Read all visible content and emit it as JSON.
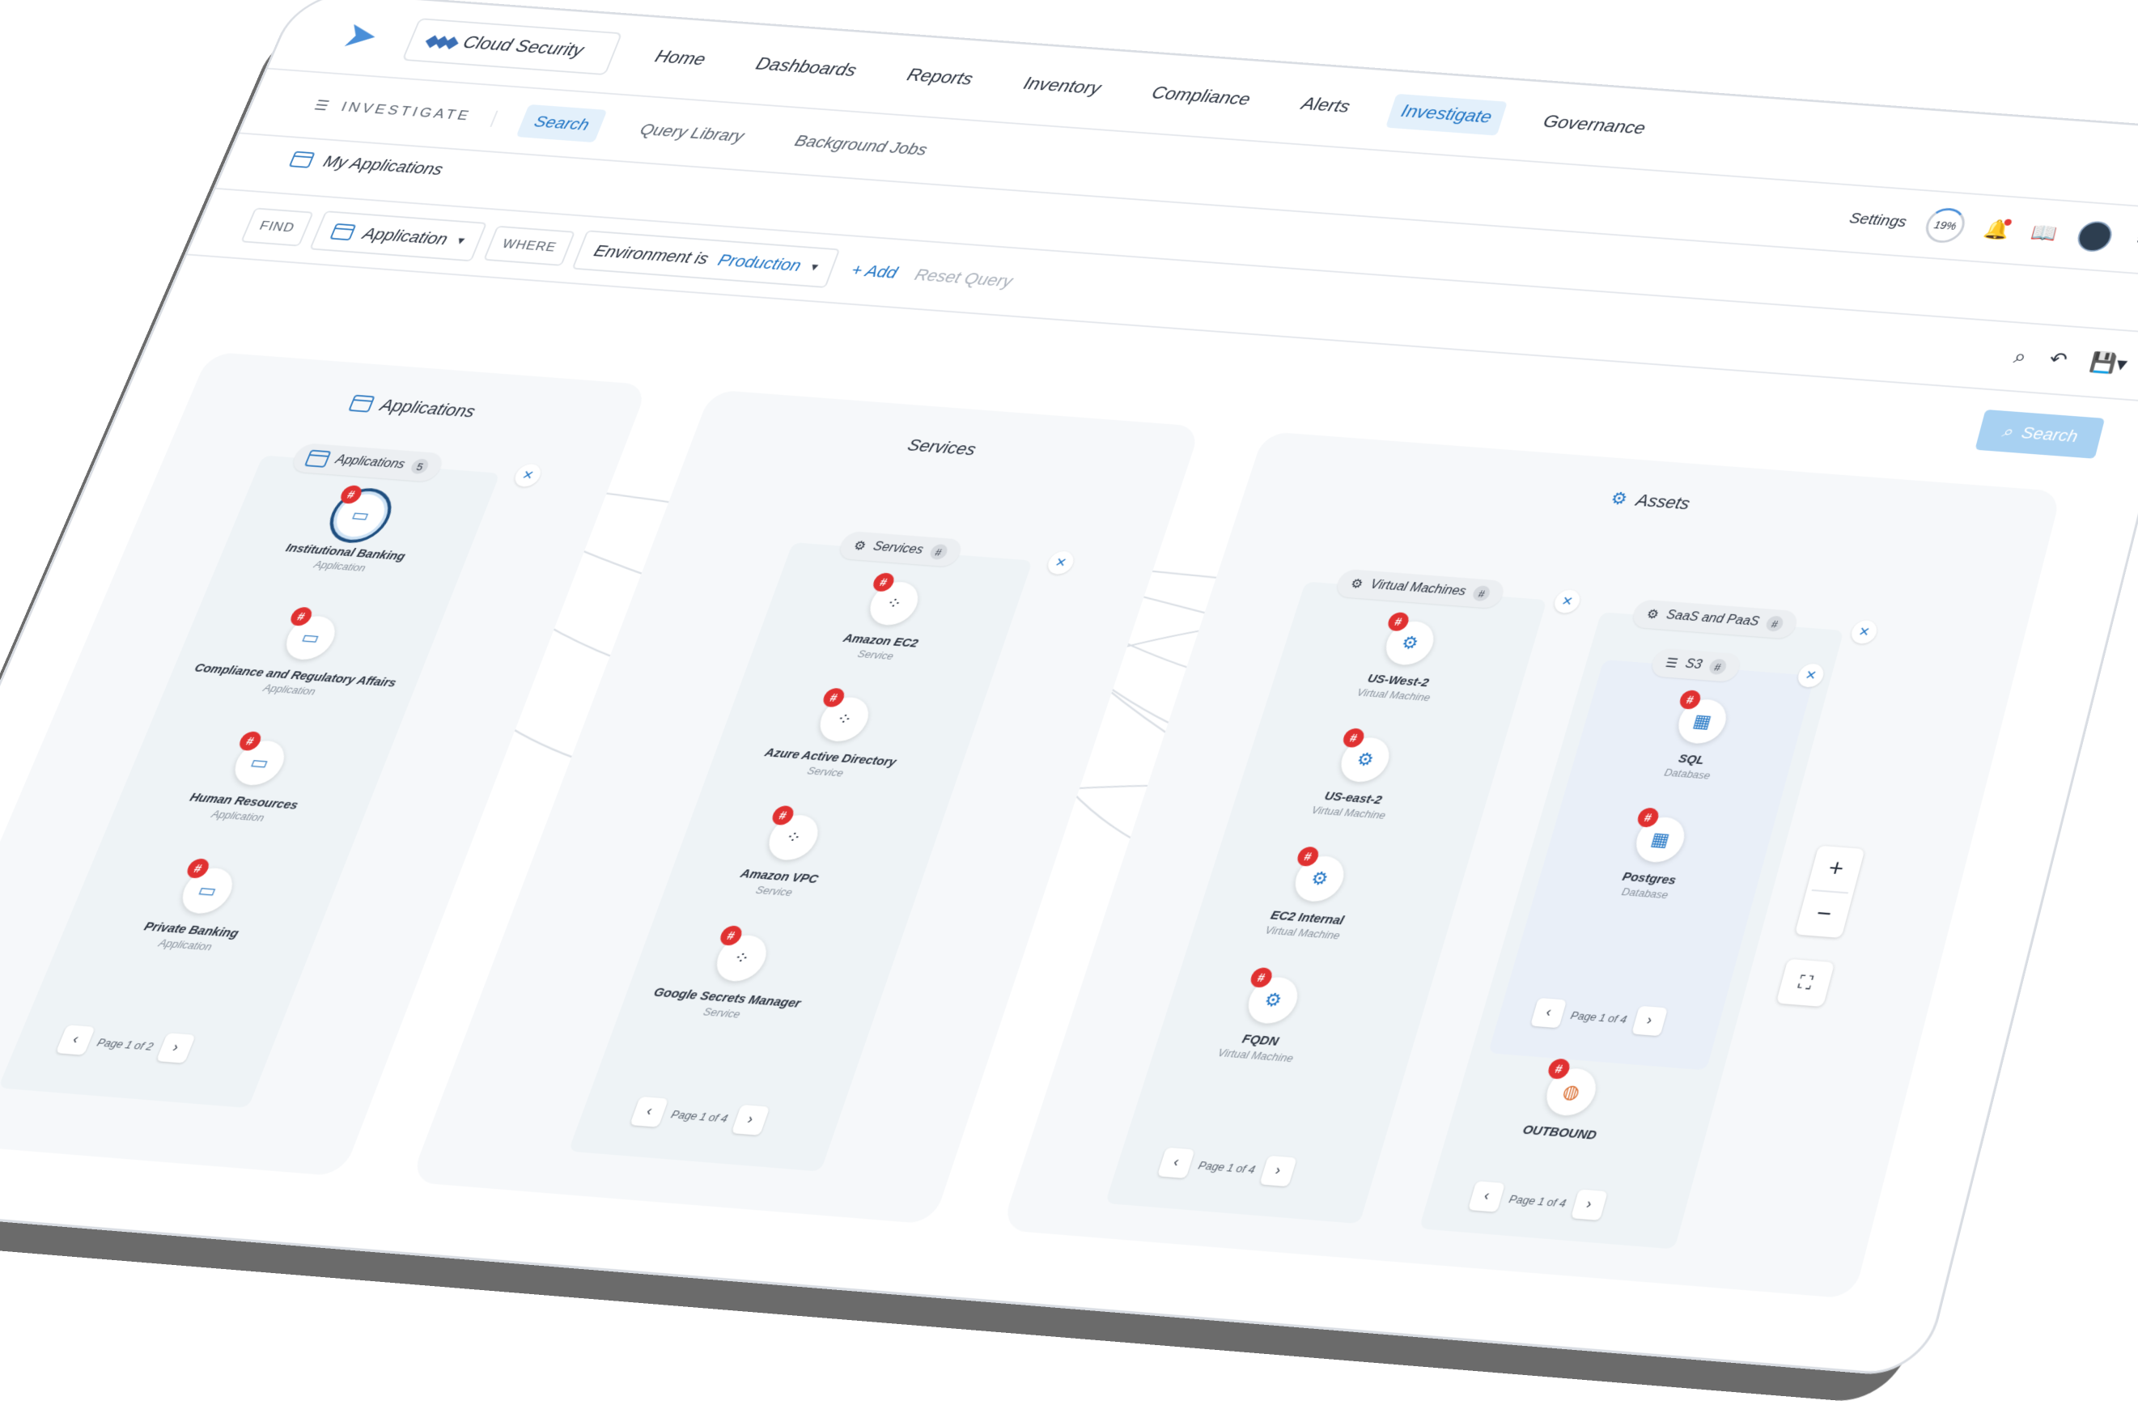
{
  "topnav": {
    "brand": "Cloud Security",
    "items": [
      "Home",
      "Dashboards",
      "Reports",
      "Inventory",
      "Compliance",
      "Alerts",
      "Investigate",
      "Governance"
    ],
    "active": "Investigate"
  },
  "subbar": {
    "section_label": "INVESTIGATE",
    "tabs": [
      "Search",
      "Query Library",
      "Background Jobs"
    ],
    "active_tab": "Search",
    "settings_label": "Settings",
    "progress_label": "19%",
    "progress_value": 0.19
  },
  "page": {
    "title": "My Applications"
  },
  "query": {
    "find_label": "FIND",
    "find_value": "Application",
    "where_label": "WHERE",
    "condition_prefix": "Environment is",
    "condition_value": "Production",
    "add_label": "Add",
    "reset_label": "Reset Query",
    "search_label": "Search"
  },
  "graph": {
    "applications": {
      "title": "Applications",
      "group_label": "Applications",
      "group_count": "5",
      "nodes": [
        {
          "name": "Institutional Banking",
          "type": "Application",
          "badge": "#"
        },
        {
          "name": "Compliance and Regulatory Affairs",
          "type": "Application",
          "badge": "#"
        },
        {
          "name": "Human Resources",
          "type": "Application",
          "badge": "#"
        },
        {
          "name": "Private Banking",
          "type": "Application",
          "badge": "#"
        }
      ],
      "pager": "Page 1 of 2"
    },
    "services": {
      "title": "Services",
      "group_label": "Services",
      "group_count": "#",
      "nodes": [
        {
          "name": "Amazon EC2",
          "type": "Service",
          "badge": "#"
        },
        {
          "name": "Azure Active Directory",
          "type": "Service",
          "badge": "#"
        },
        {
          "name": "Amazon VPC",
          "type": "Service",
          "badge": "#"
        },
        {
          "name": "Google Secrets Manager",
          "type": "Service",
          "badge": "#"
        }
      ],
      "pager": "Page 1 of 4"
    },
    "assets": {
      "title": "Assets",
      "vm_group": {
        "label": "Virtual Machines",
        "count": "#",
        "nodes": [
          {
            "name": "US-West-2",
            "type": "Virtual Machine",
            "badge": "#"
          },
          {
            "name": "US-east-2",
            "type": "Virtual Machine",
            "badge": "#"
          },
          {
            "name": "EC2 Internal",
            "type": "Virtual Machine",
            "badge": "#"
          },
          {
            "name": "FQDN",
            "type": "Virtual Machine",
            "badge": "#"
          }
        ],
        "pager": "Page 1 of 4"
      },
      "saas_group": {
        "label": "SaaS and PaaS",
        "count": "#",
        "s3_label": "S3",
        "s3_count": "#",
        "nodes": [
          {
            "name": "SQL",
            "type": "Database",
            "badge": "#"
          },
          {
            "name": "Postgres",
            "type": "Database",
            "badge": "#"
          }
        ],
        "pager_inner": "Page 1 of 4",
        "outbound": {
          "name": "OUTBOUND",
          "badge": "#"
        },
        "pager": "Page 1 of 4"
      }
    }
  }
}
